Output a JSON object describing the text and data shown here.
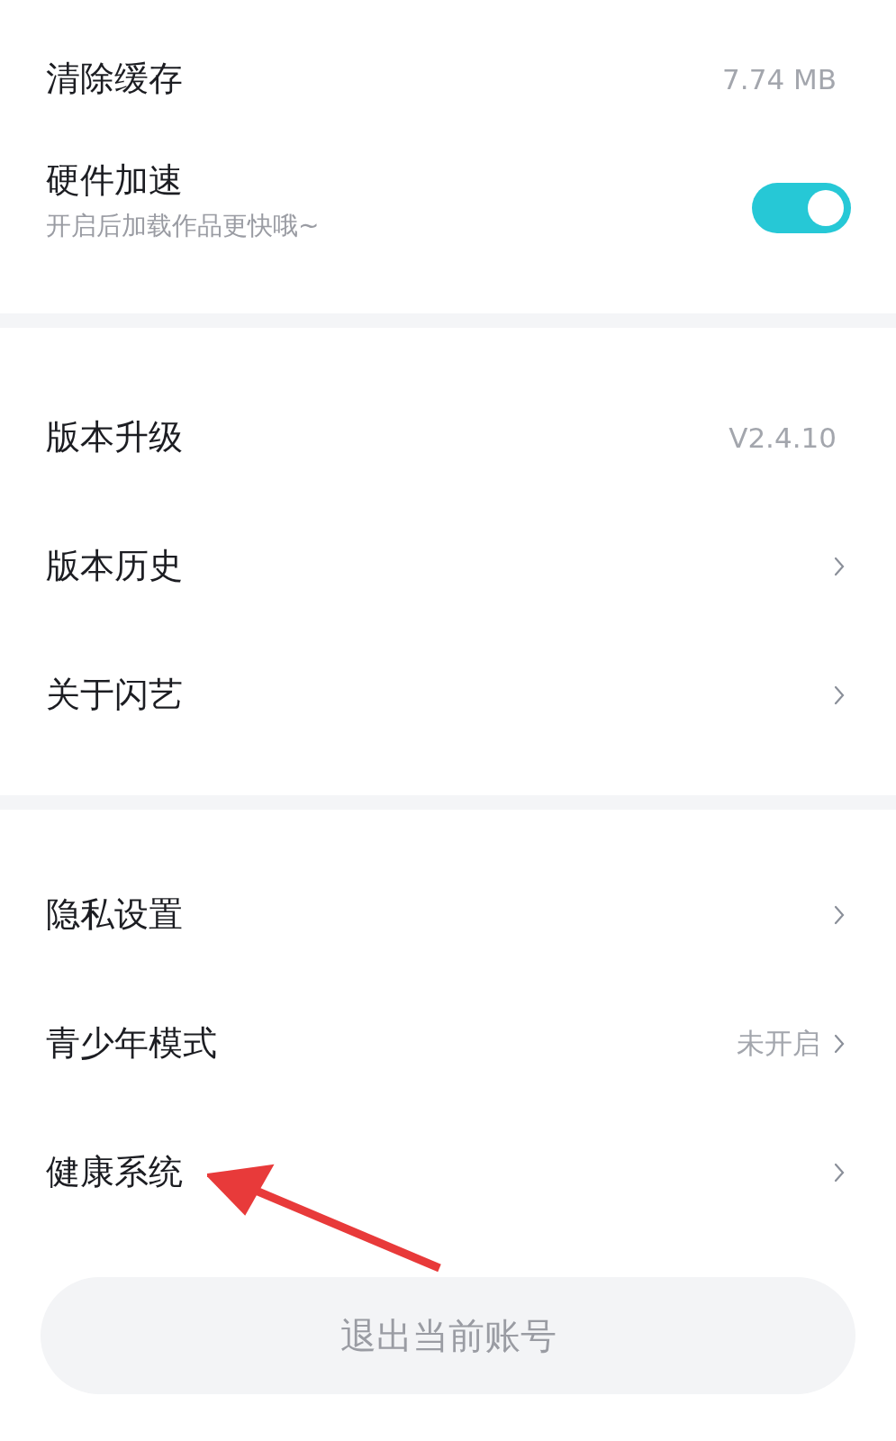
{
  "sections": [
    {
      "items": [
        {
          "kind": "value",
          "label": "清除缓存",
          "value": "7.74 MB"
        },
        {
          "kind": "toggle",
          "label": "硬件加速",
          "subtitle": "开启后加载作品更快哦~",
          "on": true
        }
      ]
    },
    {
      "items": [
        {
          "kind": "value",
          "label": "版本升级",
          "value": "V2.4.10"
        },
        {
          "kind": "link",
          "label": "版本历史"
        },
        {
          "kind": "link",
          "label": "关于闪艺"
        }
      ]
    },
    {
      "items": [
        {
          "kind": "link",
          "label": "隐私设置"
        },
        {
          "kind": "link",
          "label": "青少年模式",
          "value": "未开启"
        },
        {
          "kind": "link",
          "label": "健康系统"
        }
      ]
    }
  ],
  "logout_button": "退出当前账号"
}
